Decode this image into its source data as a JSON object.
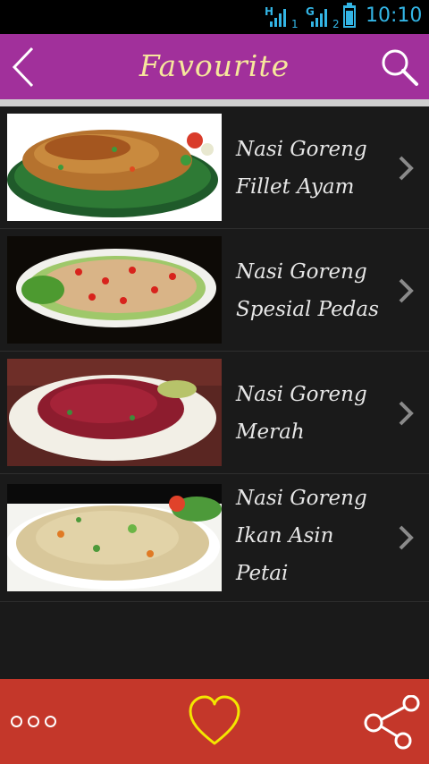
{
  "status_bar": {
    "network_1": "H",
    "sim_1": "1",
    "network_2": "G",
    "sim_2": "2",
    "time": "10:10",
    "icons": [
      "signal-icon",
      "signal-icon",
      "battery-icon"
    ]
  },
  "header": {
    "title": "Favourite",
    "back_icon": "chevron-left-icon",
    "search_icon": "search-icon",
    "color": "#a1309b",
    "title_color": "#f6e79c"
  },
  "list": {
    "items": [
      {
        "lines": [
          "Nasi Goreng",
          "Fillet Ayam"
        ],
        "image": "fried rice with chicken fillet on banana leaf"
      },
      {
        "lines": [
          "Nasi Goreng",
          "Spesial Pedas"
        ],
        "image": "spicy fried rice with chili slices"
      },
      {
        "lines": [
          "Nasi Goreng",
          "Merah"
        ],
        "image": "red fried rice on white plate"
      },
      {
        "lines": [
          "Nasi Goreng",
          "Ikan Asin",
          "Petai"
        ],
        "image": "fried rice with salted fish and petai"
      }
    ]
  },
  "bottom_bar": {
    "more_icon": "more-dots-icon",
    "favourite_icon": "heart-icon",
    "share_icon": "share-icon",
    "color": "#c4372a"
  }
}
